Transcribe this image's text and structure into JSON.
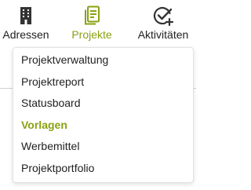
{
  "colors": {
    "accent": "#8aa211",
    "text": "#1f1f1f",
    "icon": "#333333"
  },
  "nav": {
    "items": [
      {
        "label": "Adressen",
        "icon": "building-icon",
        "active": false
      },
      {
        "label": "Projekte",
        "icon": "clipboard-list-icon",
        "active": true
      },
      {
        "label": "Aktivitäten",
        "icon": "check-circle-plus-icon",
        "active": false
      }
    ]
  },
  "dropdown": {
    "items": [
      {
        "label": "Projektverwaltung",
        "active": false
      },
      {
        "label": "Projektreport",
        "active": false
      },
      {
        "label": "Statusboard",
        "active": false
      },
      {
        "label": "Vorlagen",
        "active": true
      },
      {
        "label": "Werbemittel",
        "active": false
      },
      {
        "label": "Projektportfolio",
        "active": false
      }
    ]
  }
}
